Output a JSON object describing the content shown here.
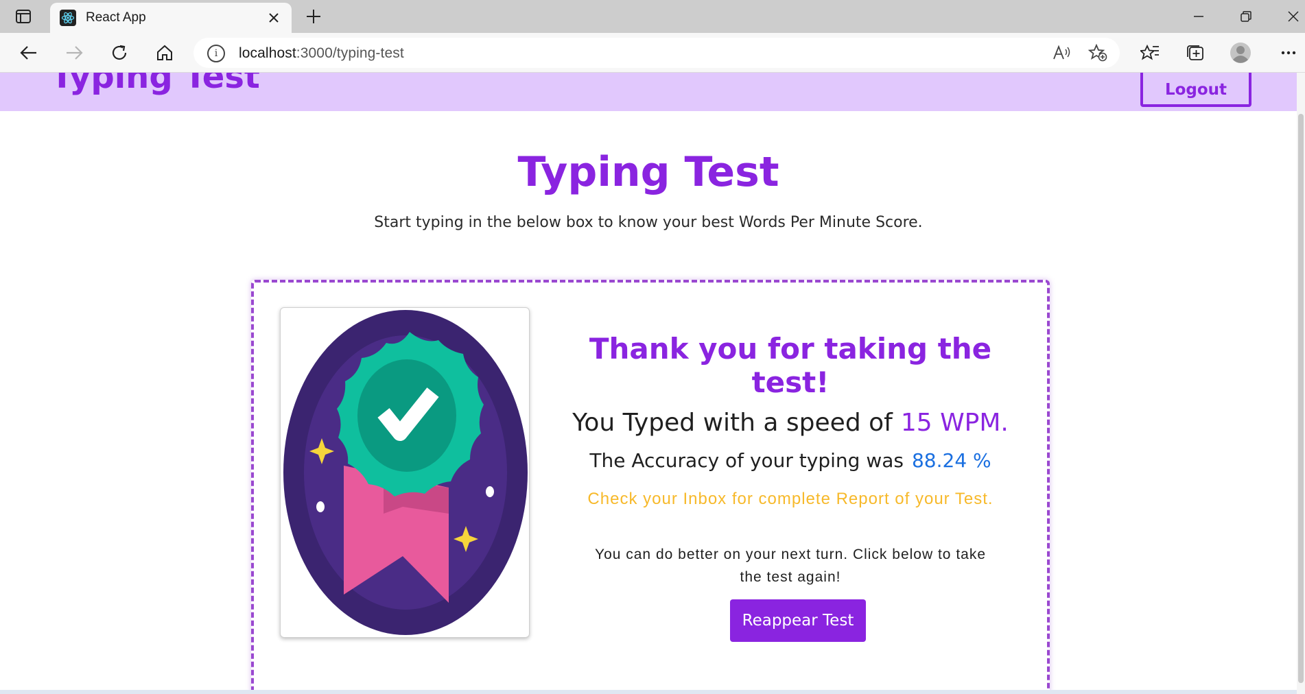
{
  "browser": {
    "tab_title": "React App",
    "address_host": "localhost",
    "address_path": ":3000/typing-test",
    "icons": [
      "tab-actions-icon",
      "react-favicon-icon",
      "close-icon",
      "plus-icon",
      "minimize-icon",
      "restore-icon",
      "window-close-icon",
      "back-icon",
      "forward-icon",
      "refresh-icon",
      "home-icon",
      "info-icon",
      "read-aloud-icon",
      "add-favorite-icon",
      "favorites-icon",
      "collections-icon",
      "profile-icon",
      "more-icon"
    ]
  },
  "navbar": {
    "brand": "Typing Test",
    "logout_label": "Logout"
  },
  "main": {
    "title": "Typing Test",
    "subtitle": "Start typing in the below box to know your best Words Per Minute Score."
  },
  "result": {
    "thanks": "Thank you for taking the test!",
    "speed_label": "You Typed with a speed of",
    "speed_value": "15 WPM.",
    "accuracy_label": "The Accuracy of your typing was",
    "accuracy_value": "88.24 %",
    "inbox_message": "Check your Inbox for complete Report of your Test.",
    "encourage_message": "You can do better on your next turn. Click below to take the test again!",
    "reappear_label": "Reappear Test"
  },
  "colors": {
    "accent": "#8a24e0",
    "navbar_bg": "#e1c8fd",
    "accuracy": "#1a6fe0",
    "inbox": "#f7b92a"
  }
}
